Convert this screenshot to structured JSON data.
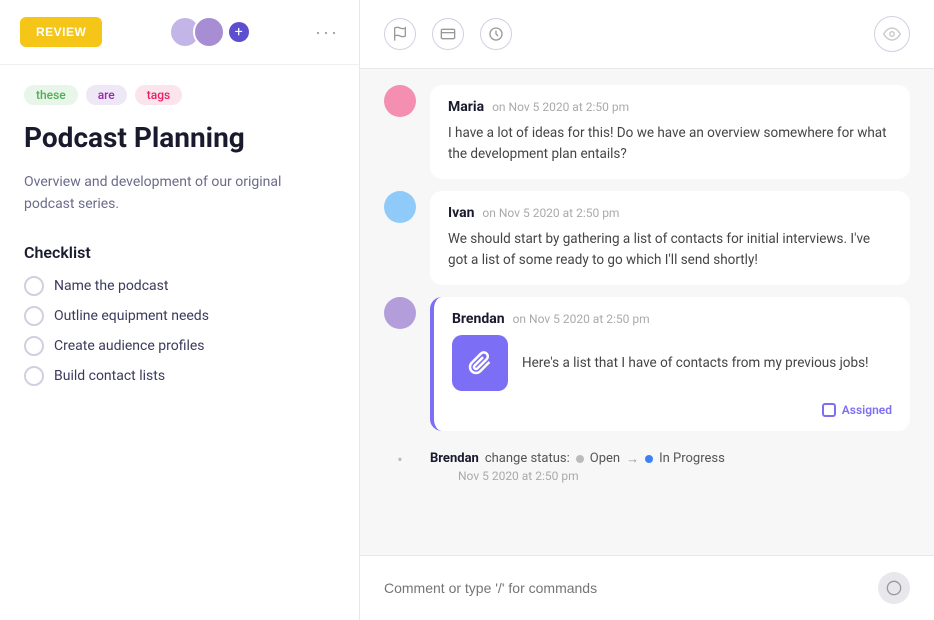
{
  "left": {
    "review_label": "REVIEW",
    "more_dots": "···",
    "tags": [
      {
        "text": "these",
        "style": "tag-green"
      },
      {
        "text": "are",
        "style": "tag-purple"
      },
      {
        "text": "tags",
        "style": "tag-red"
      }
    ],
    "title": "Podcast Planning",
    "description": "Overview and development of our original podcast series.",
    "checklist_title": "Checklist",
    "checklist_items": [
      "Name the podcast",
      "Outline equipment needs",
      "Create audience profiles",
      "Build contact lists"
    ]
  },
  "right": {
    "messages": [
      {
        "sender": "Maria",
        "time": "on Nov 5 2020 at 2:50 pm",
        "text": "I have a lot of ideas for this! Do we have an overview somewhere for what the development plan entails?",
        "avatar_color": "#f48fb1",
        "highlighted": false
      },
      {
        "sender": "Ivan",
        "time": "on Nov 5 2020 at 2:50 pm",
        "text": "We should start by gathering a list of contacts for initial interviews. I've got a list of some ready to go which I'll send shortly!",
        "avatar_color": "#90caf9",
        "highlighted": false
      },
      {
        "sender": "Brendan",
        "time": "on Nov 5 2020 at 2:50 pm",
        "text": "Here's a list that I have of contacts from my previous jobs!",
        "avatar_color": "#b39ddb",
        "highlighted": true,
        "has_attachment": true,
        "assigned_label": "Assigned"
      }
    ],
    "status_change": {
      "actor": "Brendan",
      "action": "change status:",
      "from": "Open",
      "to": "In Progress",
      "time": "Nov 5 2020 at 2:50 pm"
    },
    "comment_placeholder": "Comment or type '/' for commands"
  }
}
